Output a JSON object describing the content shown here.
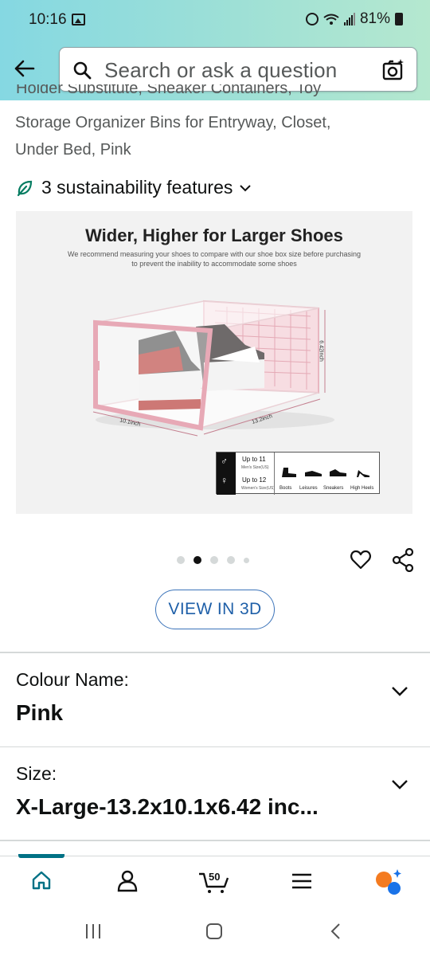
{
  "status_bar": {
    "time": "10:16",
    "battery": "81%"
  },
  "search": {
    "placeholder": "Search or ask a question"
  },
  "product": {
    "title_line_partial": "Holder Substitute, Sneaker Containers, Toy",
    "title_line_2": "Storage Organizer Bins for Entryway, Closet,",
    "title_line_3": "Under Bed, Pink",
    "sustainability": "3 sustainability features"
  },
  "image": {
    "heading": "Wider, Higher for Larger Shoes",
    "subtitle_1": "We recommend measuring your shoes to compare with our shoe box size before purchasing",
    "subtitle_2": "to prevent the inability to accommodate some shoes",
    "dim_height": "6.42inch",
    "dim_depth": "10.1inch",
    "dim_width": "13.2inch",
    "mens_size": "Up to 11",
    "mens_size_sub": "Men's Size(US)",
    "womens_size": "Up to 12",
    "womens_size_sub": "Women's Size(US)",
    "categories": [
      "Boots",
      "Leisures",
      "Sneakers",
      "High Heels"
    ]
  },
  "carousel": {
    "total": 5,
    "active_index": 1
  },
  "view3d_label": "VIEW IN 3D",
  "colour": {
    "label": "Colour Name:",
    "value": "Pink"
  },
  "size": {
    "label": "Size:",
    "value": "X-Large-13.2x10.1x6.42 inc..."
  },
  "bottom_nav": {
    "cart_count": "50"
  },
  "colors": {
    "header_start": "#85d8e2",
    "header_end": "#b5e8cf",
    "active_tab": "#007185",
    "link_blue": "#1e5fa8",
    "rufus_orange": "#f47b20",
    "rufus_blue": "#1a73e8"
  }
}
